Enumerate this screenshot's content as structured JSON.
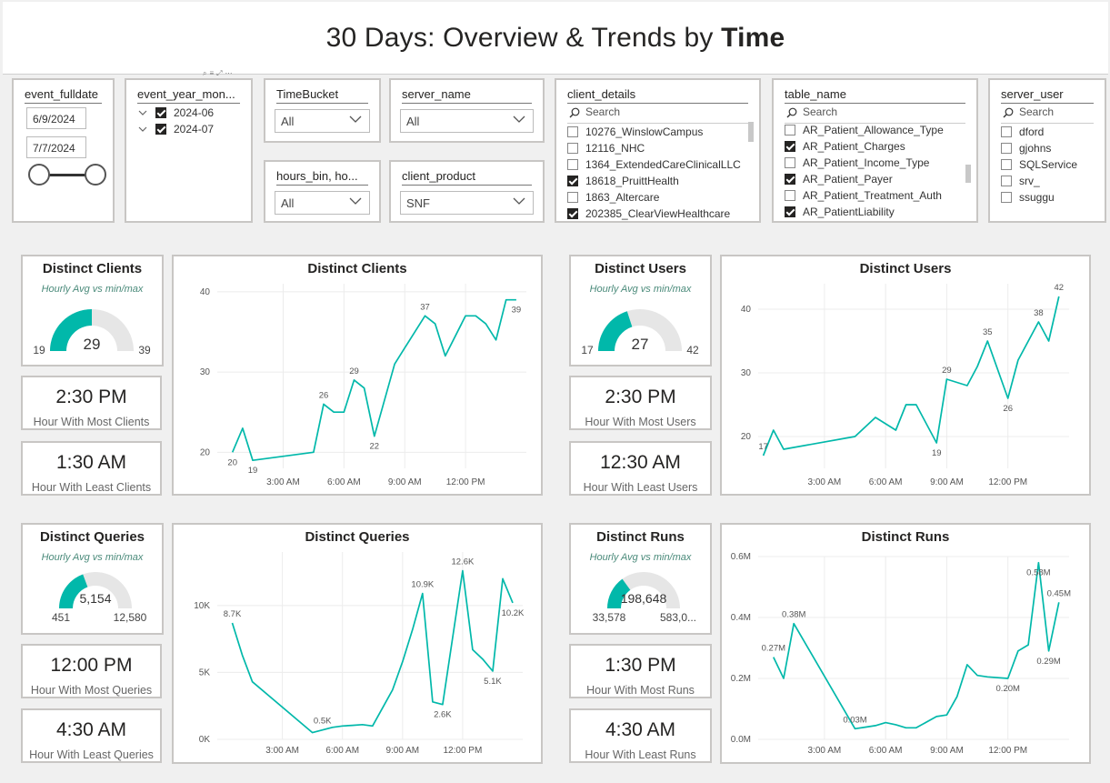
{
  "header": {
    "title_prefix": "30 Days: Overview & Trends by ",
    "title_bold": "Time"
  },
  "slicers": {
    "fulldate": {
      "title": "event_fulldate",
      "start": "6/9/2024",
      "end": "7/7/2024"
    },
    "yearmonth": {
      "title": "event_year_mon...",
      "items": [
        {
          "label": "2024-06",
          "checked": true
        },
        {
          "label": "2024-07",
          "checked": true
        }
      ]
    },
    "timebucket": {
      "title": "TimeBucket",
      "value": "All"
    },
    "hoursbin": {
      "title": "hours_bin, ho...",
      "value": "All"
    },
    "server_name": {
      "title": "server_name",
      "value": "All"
    },
    "client_product": {
      "title": "client_product",
      "value": "SNF"
    },
    "client_details": {
      "title": "client_details",
      "search": "Search",
      "items": [
        {
          "label": "10276_WinslowCampus",
          "checked": false
        },
        {
          "label": "12116_NHC",
          "checked": false
        },
        {
          "label": "1364_ExtendedCareClinicalLLC",
          "checked": false
        },
        {
          "label": "18618_PruittHealth",
          "checked": true
        },
        {
          "label": "1863_Altercare",
          "checked": false
        },
        {
          "label": "202385_ClearViewHealthcare",
          "checked": true
        }
      ]
    },
    "table_name": {
      "title": "table_name",
      "search": "Search",
      "items": [
        {
          "label": "AR_Patient_Allowance_Type",
          "checked": false
        },
        {
          "label": "AR_Patient_Charges",
          "checked": true
        },
        {
          "label": "AR_Patient_Income_Type",
          "checked": false
        },
        {
          "label": "AR_Patient_Payer",
          "checked": true
        },
        {
          "label": "AR_Patient_Treatment_Auth",
          "checked": false
        },
        {
          "label": "AR_PatientLiability",
          "checked": true
        }
      ]
    },
    "server_user": {
      "title": "server_user",
      "search": "Search",
      "items": [
        {
          "label": "dford",
          "checked": false
        },
        {
          "label": "gjohns",
          "checked": false
        },
        {
          "label": "SQLService",
          "checked": false
        },
        {
          "label": "srv_",
          "checked": false
        },
        {
          "label": "ssuggu",
          "checked": false
        }
      ]
    }
  },
  "gauges": {
    "clients": {
      "title": "Distinct Clients",
      "subtitle": "Hourly Avg vs min/max",
      "value": 29,
      "min": 19,
      "max": 39,
      "value_label": "29",
      "min_label": "19",
      "max_label": "39"
    },
    "users": {
      "title": "Distinct Users",
      "subtitle": "Hourly Avg vs min/max",
      "value": 27,
      "min": 17,
      "max": 42,
      "value_label": "27",
      "min_label": "17",
      "max_label": "42"
    },
    "queries": {
      "title": "Distinct Queries",
      "subtitle": "Hourly Avg vs min/max",
      "value": 5154,
      "min": 451,
      "max": 12580,
      "value_label": "5,154",
      "min_label": "451",
      "max_label": "12,580"
    },
    "runs": {
      "title": "Distinct Runs",
      "subtitle": "Hourly Avg vs min/max",
      "value": 198648,
      "min": 33578,
      "max": 583000,
      "value_label": "198,648",
      "min_label": "33,578",
      "max_label": "583,0..."
    }
  },
  "kpis": {
    "clients_most": {
      "value": "2:30 PM",
      "label": "Hour With Most Clients"
    },
    "clients_least": {
      "value": "1:30 AM",
      "label": "Hour With Least Clients"
    },
    "users_most": {
      "value": "2:30 PM",
      "label": "Hour With Most Users"
    },
    "users_least": {
      "value": "12:30 AM",
      "label": "Hour With Least Users"
    },
    "queries_most": {
      "value": "12:00 PM",
      "label": "Hour With Most Queries"
    },
    "queries_least": {
      "value": "4:30 AM",
      "label": "Hour With Least Queries"
    },
    "runs_most": {
      "value": "1:30 PM",
      "label": "Hour With Most Runs"
    },
    "runs_least": {
      "value": "4:30 AM",
      "label": "Hour With Least Runs"
    }
  },
  "colors": {
    "accent": "#01b8aa",
    "gauge_bg": "#e6e6e6",
    "grid": "#ececec"
  },
  "chart_data": [
    {
      "type": "line",
      "title": "Distinct Clients",
      "x": [
        0.5,
        1,
        1.5,
        4.5,
        5,
        5.5,
        6,
        6.5,
        7,
        7.5,
        8.5,
        9,
        10,
        10.5,
        11,
        12,
        12.5,
        13,
        13.5,
        14,
        14.5
      ],
      "y": [
        20,
        23,
        19,
        20,
        26,
        25,
        25,
        29,
        28,
        22,
        31,
        33,
        37,
        36,
        32,
        37,
        37,
        36,
        34,
        39,
        39
      ],
      "x_ticks": [
        "3:00 AM",
        "6:00 AM",
        "9:00 AM",
        "12:00 PM"
      ],
      "x_tick_values": [
        3,
        6,
        9,
        12
      ],
      "y_ticks": [
        "20",
        "30",
        "40"
      ],
      "y_tick_values": [
        20,
        30,
        40
      ],
      "ylim": [
        18,
        41
      ],
      "data_labels": [
        {
          "i": 0,
          "text": "20",
          "pos": "below"
        },
        {
          "i": 2,
          "text": "19",
          "pos": "below"
        },
        {
          "i": 4,
          "text": "26",
          "pos": "above"
        },
        {
          "i": 7,
          "text": "29",
          "pos": "above"
        },
        {
          "i": 9,
          "text": "22",
          "pos": "below"
        },
        {
          "i": 12,
          "text": "37",
          "pos": "above"
        },
        {
          "i": 20,
          "text": "39",
          "pos": "below"
        }
      ]
    },
    {
      "type": "line",
      "title": "Distinct Users",
      "x": [
        0,
        0.5,
        1,
        4.5,
        5.5,
        6.5,
        7,
        7.5,
        8.5,
        9,
        10,
        10.5,
        11,
        12,
        12.5,
        13.5,
        14,
        14.5
      ],
      "y": [
        17,
        21,
        18,
        20,
        23,
        21,
        25,
        25,
        19,
        29,
        28,
        31,
        35,
        26,
        32,
        38,
        35,
        42
      ],
      "x_ticks": [
        "3:00 AM",
        "6:00 AM",
        "9:00 AM",
        "12:00 PM"
      ],
      "x_tick_values": [
        3,
        6,
        9,
        12
      ],
      "y_ticks": [
        "20",
        "30",
        "40"
      ],
      "y_tick_values": [
        20,
        30,
        40
      ],
      "ylim": [
        15,
        44
      ],
      "data_labels": [
        {
          "i": 0,
          "text": "17",
          "pos": "above"
        },
        {
          "i": 8,
          "text": "19",
          "pos": "below"
        },
        {
          "i": 9,
          "text": "29",
          "pos": "above"
        },
        {
          "i": 12,
          "text": "35",
          "pos": "above"
        },
        {
          "i": 13,
          "text": "26",
          "pos": "below"
        },
        {
          "i": 15,
          "text": "38",
          "pos": "above"
        },
        {
          "i": 17,
          "text": "42",
          "pos": "above"
        }
      ]
    },
    {
      "type": "line",
      "title": "Distinct Queries",
      "x": [
        0.5,
        1,
        1.5,
        4.5,
        5,
        5.5,
        6,
        6.5,
        7,
        7.5,
        8.5,
        9,
        9.5,
        10,
        10.5,
        11,
        12,
        12.5,
        13,
        13.5,
        14,
        14.5
      ],
      "y": [
        8700,
        6300,
        4300,
        500,
        700,
        900,
        1000,
        1050,
        1100,
        1000,
        3700,
        5800,
        8200,
        10900,
        2800,
        2600,
        12600,
        6700,
        6000,
        5100,
        12000,
        10200
      ],
      "x_ticks": [
        "3:00 AM",
        "6:00 AM",
        "9:00 AM",
        "12:00 PM"
      ],
      "x_tick_values": [
        3,
        6,
        9,
        12
      ],
      "y_ticks": [
        "0K",
        "5K",
        "10K"
      ],
      "y_tick_values": [
        0,
        5000,
        10000
      ],
      "ylim": [
        0,
        14000
      ],
      "data_labels": [
        {
          "i": 0,
          "text": "8.7K",
          "pos": "above"
        },
        {
          "i": 4,
          "text": "0.5K",
          "pos": "above"
        },
        {
          "i": 13,
          "text": "10.9K",
          "pos": "above"
        },
        {
          "i": 15,
          "text": "2.6K",
          "pos": "below"
        },
        {
          "i": 16,
          "text": "12.6K",
          "pos": "above"
        },
        {
          "i": 19,
          "text": "5.1K",
          "pos": "below"
        },
        {
          "i": 21,
          "text": "10.2K",
          "pos": "below"
        }
      ]
    },
    {
      "type": "line",
      "title": "Distinct Runs",
      "x": [
        0.5,
        1,
        1.5,
        4.5,
        5,
        5.5,
        6,
        6.5,
        7,
        7.5,
        8.5,
        9,
        9.5,
        10,
        10.5,
        11,
        12,
        12.5,
        13,
        13.5,
        14,
        14.5
      ],
      "y": [
        270000,
        200000,
        380000,
        35000,
        40000,
        45000,
        55000,
        48000,
        38000,
        38000,
        75000,
        80000,
        140000,
        245000,
        210000,
        205000,
        200000,
        290000,
        310000,
        580000,
        290000,
        450000
      ],
      "x_ticks": [
        "3:00 AM",
        "6:00 AM",
        "9:00 AM",
        "12:00 PM"
      ],
      "x_tick_values": [
        3,
        6,
        9,
        12
      ],
      "y_ticks": [
        "0.0M",
        "0.2M",
        "0.4M",
        "0.6M"
      ],
      "y_tick_values": [
        0,
        200000,
        400000,
        600000
      ],
      "ylim": [
        0,
        600000
      ],
      "data_labels": [
        {
          "i": 0,
          "text": "0.27M",
          "pos": "above"
        },
        {
          "i": 2,
          "text": "0.38M",
          "pos": "above"
        },
        {
          "i": 3,
          "text": "0.03M",
          "pos": "above"
        },
        {
          "i": 16,
          "text": "0.20M",
          "pos": "below"
        },
        {
          "i": 19,
          "text": "0.58M",
          "pos": "below"
        },
        {
          "i": 20,
          "text": "0.29M",
          "pos": "below"
        },
        {
          "i": 21,
          "text": "0.45M",
          "pos": "above"
        }
      ]
    }
  ]
}
